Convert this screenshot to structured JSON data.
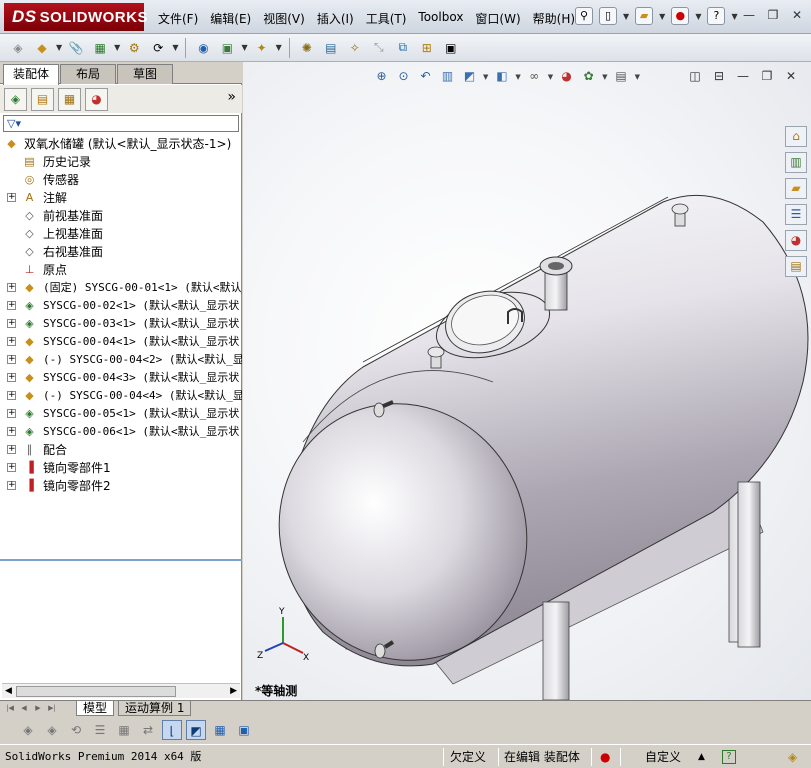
{
  "app": {
    "logo_ds": "DS",
    "logo_text": "SOLIDWORKS"
  },
  "menu": [
    "文件(F)",
    "编辑(E)",
    "视图(V)",
    "插入(I)",
    "工具(T)",
    "Toolbox",
    "窗口(W)",
    "帮助(H)"
  ],
  "panel_tabs": [
    "装配体",
    "布局",
    "草图"
  ],
  "tree": {
    "root": "双氧水储罐  (默认<默认_显示状态-1>)",
    "items": [
      {
        "label": "历史记录",
        "icon": "history-icon",
        "expand": false
      },
      {
        "label": "传感器",
        "icon": "sensor-icon",
        "expand": false
      },
      {
        "label": "注解",
        "icon": "annotation-icon",
        "expand": true
      },
      {
        "label": "前视基准面",
        "icon": "plane-icon",
        "expand": false
      },
      {
        "label": "上视基准面",
        "icon": "plane-icon",
        "expand": false
      },
      {
        "label": "右视基准面",
        "icon": "plane-icon",
        "expand": false
      },
      {
        "label": "原点",
        "icon": "origin-icon",
        "expand": false
      },
      {
        "label": "(固定) SYSCG-00-01<1> (默认<默认_",
        "icon": "part-icon",
        "expand": true,
        "mono": true
      },
      {
        "label": "SYSCG-00-02<1> (默认<默认_显示状",
        "icon": "subassembly-icon",
        "expand": true,
        "mono": true
      },
      {
        "label": "SYSCG-00-03<1> (默认<默认_显示状",
        "icon": "subassembly-icon",
        "expand": true,
        "mono": true
      },
      {
        "label": "SYSCG-00-04<1> (默认<默认_显示状",
        "icon": "part-icon",
        "expand": true,
        "mono": true
      },
      {
        "label": "(-) SYSCG-00-04<2> (默认<默认_显",
        "icon": "part-icon",
        "expand": true,
        "mono": true
      },
      {
        "label": "SYSCG-00-04<3> (默认<默认_显示状",
        "icon": "part-icon",
        "expand": true,
        "mono": true
      },
      {
        "label": "(-) SYSCG-00-04<4> (默认<默认_显",
        "icon": "part-icon",
        "expand": true,
        "mono": true
      },
      {
        "label": "SYSCG-00-05<1> (默认<默认_显示状",
        "icon": "subassembly-icon",
        "expand": true,
        "mono": true
      },
      {
        "label": "SYSCG-00-06<1> (默认<默认_显示状",
        "icon": "subassembly-icon",
        "expand": true,
        "mono": true
      },
      {
        "label": "配合",
        "icon": "mates-icon",
        "expand": true
      },
      {
        "label": "镜向零部件1",
        "icon": "mirror-icon",
        "expand": true
      },
      {
        "label": "镜向零部件2",
        "icon": "mirror-icon",
        "expand": true
      }
    ]
  },
  "viewport": {
    "view_name": "*等轴测",
    "triad": {
      "x": "X",
      "y": "Y",
      "z": "Z"
    }
  },
  "bottom_tabs": [
    "模型",
    "运动算例 1"
  ],
  "status": {
    "app_version": "SolidWorks Premium 2014 x64 版",
    "under_defined": "欠定义",
    "editing": "在编辑 装配体",
    "units": "自定义"
  },
  "colors": {
    "logo_red": "#9b0d14",
    "active_tool": "#c5d8ef",
    "tank_shade": "#9a95a0"
  }
}
